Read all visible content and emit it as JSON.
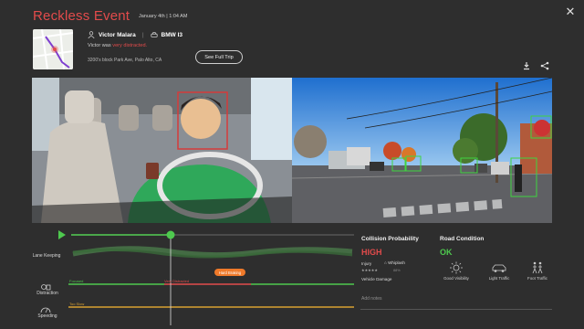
{
  "header": {
    "title": "Reckless Event",
    "date": "January 4th | 1:04 AM",
    "close_icon": "close-icon"
  },
  "trip": {
    "driver": "Victor Malara",
    "vehicle": "BMW I3",
    "message_prefix": "Victor was ",
    "message_highlight": "very distracted.",
    "address": "3200's block Park Ave, Palo Alto, CA",
    "see_full_trip": "See Full Trip"
  },
  "timeline": {
    "labels": {
      "lane_keeping": "Lane Keeping",
      "distraction": "Distraction",
      "speeding": "Speeding"
    },
    "distraction_tags": {
      "focused": "Focused",
      "very_distracted": "Very Distracted"
    },
    "speeding_tag": "Too Slow",
    "event_badge": "Hard Braking"
  },
  "collision": {
    "title": "Collision Probability",
    "level": "HIGH",
    "injury_label": "Injury",
    "injury_stars": "★★★★★",
    "injury_suffix": "88%",
    "whiplash_label": "Whiplash",
    "vehicle_damage": "Vehicle Damage",
    "add_notes_placeholder": "Add notes"
  },
  "road": {
    "title": "Road Condition",
    "level": "OK",
    "conditions": [
      {
        "label": "Good Visibility",
        "icon": "sun-icon"
      },
      {
        "label": "Light Traffic",
        "icon": "car-icon"
      },
      {
        "label": "Foot Traffic",
        "icon": "pedestrians-icon"
      }
    ]
  },
  "colors": {
    "accent_red": "#e24b4b",
    "ok_green": "#4ec94e",
    "badge_orange": "#f07a2a",
    "background": "#2e2e2e"
  }
}
